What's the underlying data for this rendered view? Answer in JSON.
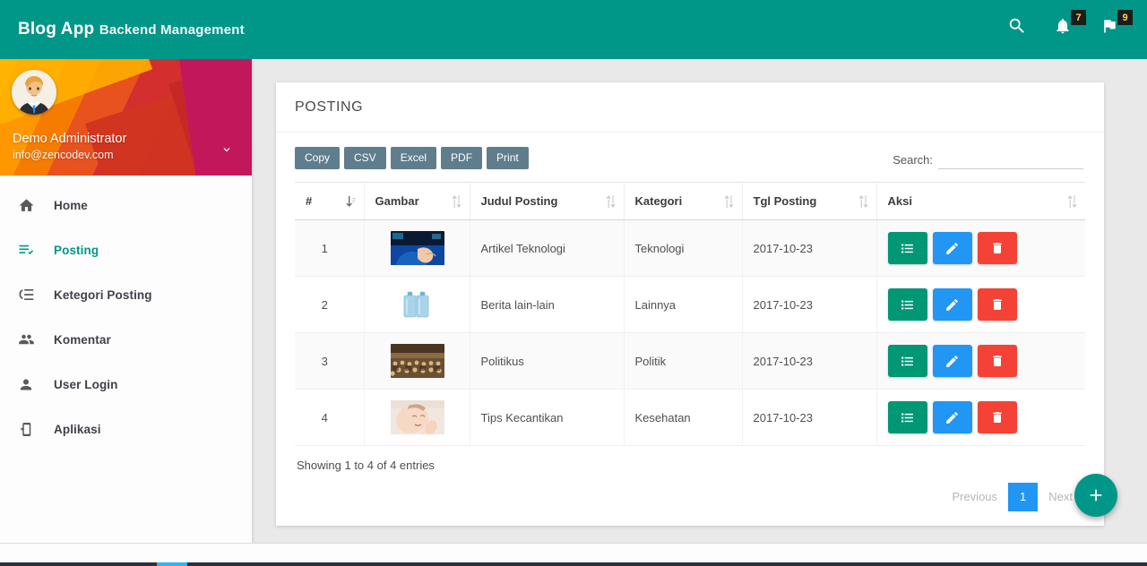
{
  "topbar": {
    "brand_bold": "Blog App",
    "brand_light": "Backend Management",
    "search_icon": "search-icon",
    "bell_icon": "bell-icon",
    "flag_icon": "flag-icon",
    "bell_badge": "7",
    "flag_badge": "9",
    "bg_color": "#009688"
  },
  "sidebar": {
    "user": {
      "name": "Demo Administrator",
      "email": "info@zencodev.com",
      "avatar_icon": "avatar",
      "caret_icon": "chevron-down-icon"
    },
    "items": [
      {
        "label": "Home",
        "icon": "home-icon",
        "active": false
      },
      {
        "label": "Posting",
        "icon": "list-check-icon",
        "active": true
      },
      {
        "label": "Ketegori Posting",
        "icon": "category-list-icon",
        "active": false
      },
      {
        "label": "Komentar",
        "icon": "people-icon",
        "active": false
      },
      {
        "label": "User Login",
        "icon": "person-icon",
        "active": false
      },
      {
        "label": "Aplikasi",
        "icon": "device-settings-icon",
        "active": false
      }
    ]
  },
  "card": {
    "title": "POSTING",
    "export_buttons": [
      "Copy",
      "CSV",
      "Excel",
      "PDF",
      "Print"
    ],
    "search": {
      "label": "Search:",
      "value": "",
      "placeholder": ""
    },
    "columns": [
      "#",
      "Gambar",
      "Judul Posting",
      "Kategori",
      "Tgl Posting",
      "Aksi"
    ],
    "rows": [
      {
        "num": "1",
        "image": "tech-thumbnail",
        "judul": "Artikel Teknologi",
        "kategori": "Teknologi",
        "tgl": "2017-10-23"
      },
      {
        "num": "2",
        "image": "water-gallon-thumbnail",
        "judul": "Berita lain-lain",
        "kategori": "Lainnya",
        "tgl": "2017-10-23"
      },
      {
        "num": "3",
        "image": "crowd-thumbnail",
        "judul": "Politikus",
        "kategori": "Politik",
        "tgl": "2017-10-23"
      },
      {
        "num": "4",
        "image": "spa-face-thumbnail",
        "judul": "Tips Kecantikan",
        "kategori": "Kesehatan",
        "tgl": "2017-10-23"
      }
    ],
    "actions": {
      "detail_icon": "list-detail-icon",
      "edit_icon": "pencil-icon",
      "delete_icon": "trash-icon",
      "detail_color": "#009775",
      "edit_color": "#2196f3",
      "delete_color": "#f44336"
    },
    "entries_info": "Showing 1 to 4 of 4 entries",
    "pagination": {
      "previous": "Previous",
      "current": "1",
      "next": "Next",
      "active_color": "#2196f3"
    }
  },
  "fab": {
    "icon": "plus-icon",
    "color": "#009688"
  }
}
